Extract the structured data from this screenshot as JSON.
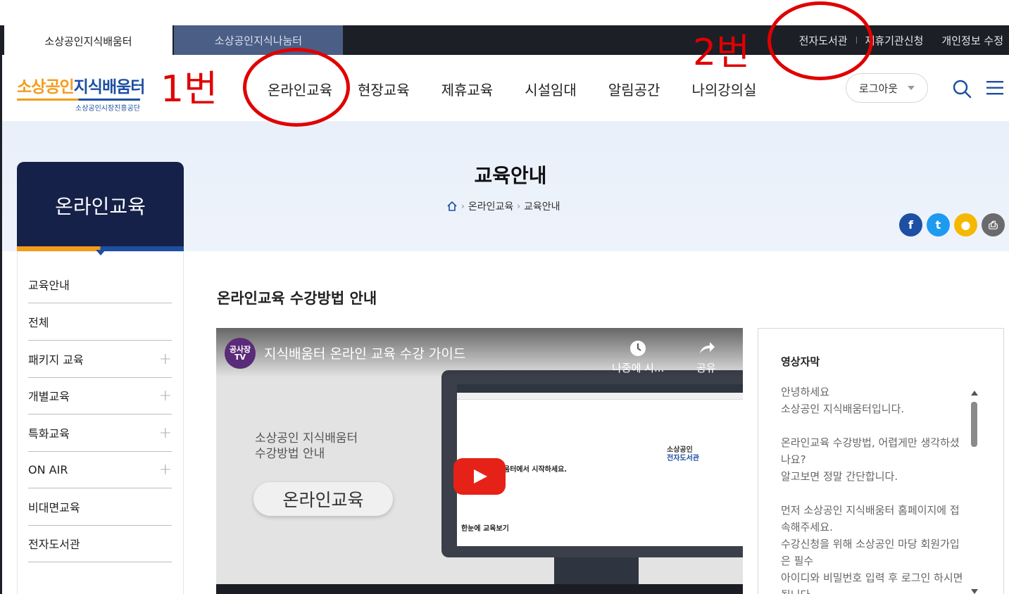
{
  "site_tabs": {
    "active": "소상공인지식배움터",
    "inactive": "소상공인지식나눔터"
  },
  "util_links": [
    "전자도서관",
    "제휴기관신청",
    "개인정보 수정"
  ],
  "logo": {
    "main_orange": "소상공인",
    "main_blue": "지식배움터",
    "sub": "소상공인시장진흥공단"
  },
  "gnb": [
    "온라인교육",
    "현장교육",
    "제휴교육",
    "시설임대",
    "알림공간",
    "나의강의실"
  ],
  "header": {
    "logout_label": "로그아웃",
    "search_icon": "search-icon",
    "menu_icon": "hamburger-menu-icon"
  },
  "page": {
    "title": "교육안내",
    "breadcrumb": [
      "온라인교육",
      "교육안내"
    ]
  },
  "share": [
    {
      "name": "facebook",
      "color": "#1d4fa3",
      "glyph": "f"
    },
    {
      "name": "twitter",
      "color": "#1d9bf0",
      "glyph": "t"
    },
    {
      "name": "kakaotalk",
      "color": "#f5b800",
      "glyph": "●"
    },
    {
      "name": "print",
      "color": "#6b6b6b",
      "glyph": "⎙"
    }
  ],
  "sidebar": {
    "title": "온라인교육",
    "items": [
      {
        "label": "교육안내",
        "expandable": false
      },
      {
        "label": "전체",
        "expandable": false
      },
      {
        "label": "패키지 교육",
        "expandable": true
      },
      {
        "label": "개별교육",
        "expandable": true
      },
      {
        "label": "특화교육",
        "expandable": true
      },
      {
        "label": "ON AIR",
        "expandable": true
      },
      {
        "label": "비대면교육",
        "expandable": false
      },
      {
        "label": "전자도서관",
        "expandable": false
      }
    ]
  },
  "content": {
    "section_title": "온라인교육 수강방법 안내",
    "video": {
      "channel_badge": "공사장 TV",
      "title": "지식배움터 온라인 교육 수강 가이드",
      "watch_later": "나중에 시...",
      "share": "공유",
      "slide_line1": "소상공인 지식배움터",
      "slide_line2": "수강방법 안내",
      "slide_pill": "온라인교육",
      "screen_headline": "움터에서 시작하세요.",
      "screen_library_1": "소상공인",
      "screen_library_2": "전자도서관",
      "screen_bottom": "한눈에 교육보기"
    },
    "subtitles": {
      "title": "영상자막",
      "paragraphs": [
        "안녕하세요\n소상공인 지식배움터입니다.",
        "온라인교육 수강방법, 어렵게만 생각하셨나요?\n알고보면 정말 간단합니다.",
        "먼저 소상공인 지식배움터 홈페이지에 접속해주세요.\n수강신청을 위해 소상공인 마당 회원가입은 필수\n아이디와 비밀번호 입력 후 로그인 하시면 됩니다."
      ]
    }
  },
  "annotations": {
    "label1": "1번",
    "label2": "2번",
    "color": "#e00000"
  }
}
